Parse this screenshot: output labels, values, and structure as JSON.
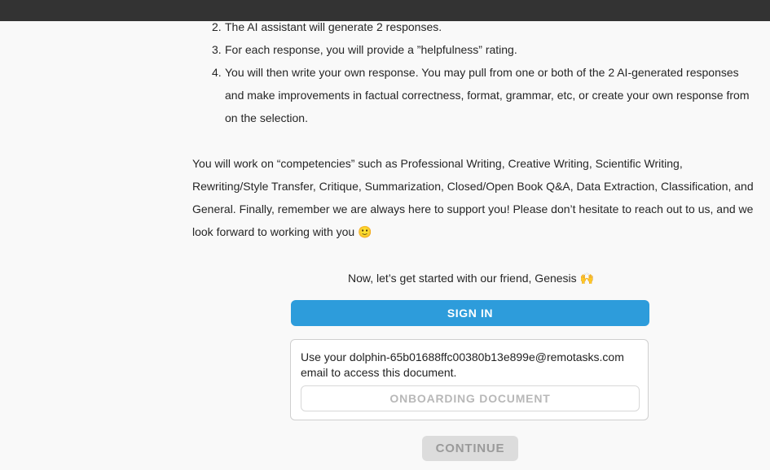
{
  "steps": [
    {
      "num": "2.",
      "text": "The AI assistant will generate 2 responses."
    },
    {
      "num": "3.",
      "text": "For each response, you will provide a ”helpfulness” rating."
    },
    {
      "num": "4.",
      "text": "You will then write your own response. You may pull from one or both of the 2 AI-generated responses and make improvements in factual correctness, format, grammar, etc, or create your own response from on the selection."
    }
  ],
  "competencies_text": "You will work on “competencies” such as Professional Writing, Creative Writing, Scientific Writing, Rewriting/Style Transfer, Critique, Summarization, Closed/Open Book Q&A, Data Extraction, Classification, and General. Finally, remember we are always here to support you! Please don’t hesitate to reach out to us, and we look forward to working with you",
  "smile_emoji": "🙂",
  "intro_text": "Now, let’s get started with our friend, Genesis",
  "hands_emoji": "🙌",
  "signin_label": "SIGN IN",
  "email_message": "Use your dolphin-65b01688ffc00380b13e899e@remotasks.com email to access this document.",
  "onboarding_doc_label": "ONBOARDING DOCUMENT",
  "continue_label": "CONTINUE"
}
